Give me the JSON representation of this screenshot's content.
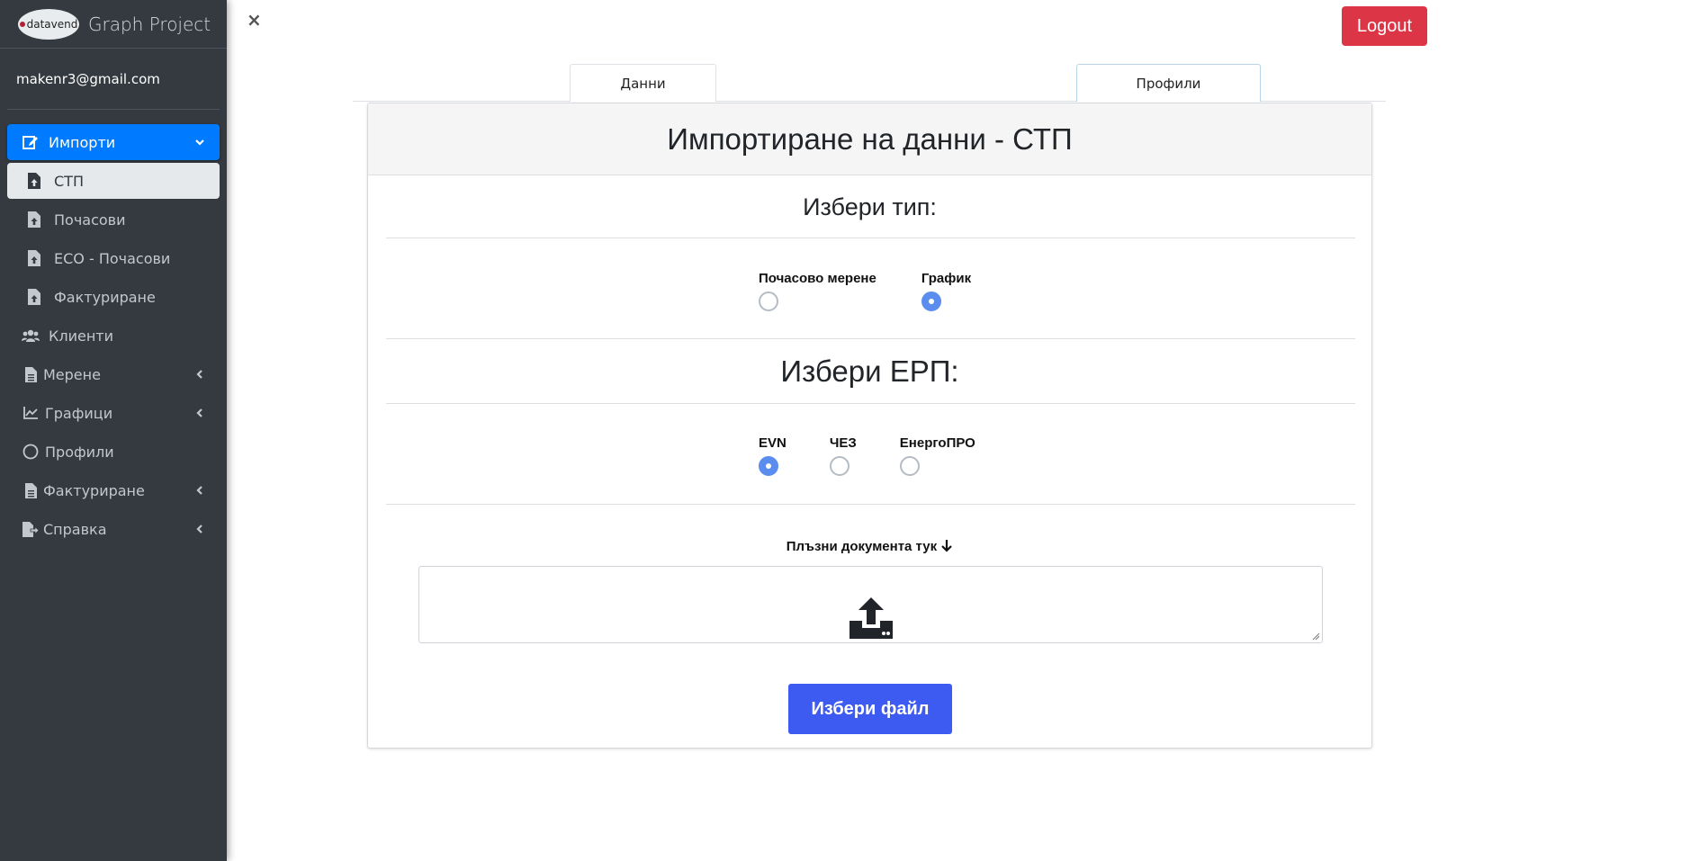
{
  "brand": {
    "logo_text": "datavend",
    "title": "Graph Project"
  },
  "user": {
    "email": "makenr3@gmail.com"
  },
  "sidebar": {
    "items": [
      {
        "label": "Импорти",
        "icon": "edit-icon"
      },
      {
        "label": "СТП",
        "icon": "file-upload-icon"
      },
      {
        "label": "Почасови",
        "icon": "file-upload-icon"
      },
      {
        "label": "ECO - Почасови",
        "icon": "file-upload-icon"
      },
      {
        "label": "Фактуриране",
        "icon": "file-upload-icon"
      },
      {
        "label": "Клиенти",
        "icon": "users-icon"
      },
      {
        "label": "Мерене",
        "icon": "file-text-icon"
      },
      {
        "label": "Графици",
        "icon": "chart-line-icon"
      },
      {
        "label": "Профили",
        "icon": "circle-icon"
      },
      {
        "label": "Фактуриране",
        "icon": "file-text-icon"
      },
      {
        "label": "Справка",
        "icon": "file-export-icon"
      }
    ]
  },
  "header": {
    "close_label": "×",
    "logout_label": "Logout"
  },
  "tabs": [
    {
      "label": "Данни"
    },
    {
      "label": "Профили"
    }
  ],
  "card": {
    "title": "Импортиране на данни - СТП",
    "type_section": {
      "title": "Избери тип:",
      "options": [
        {
          "label": "Почасово мерене",
          "checked": false
        },
        {
          "label": "График",
          "checked": true
        }
      ]
    },
    "erp_section": {
      "title": "Избери ЕРП:",
      "options": [
        {
          "label": "EVN",
          "checked": true
        },
        {
          "label": "ЧЕЗ",
          "checked": false
        },
        {
          "label": "ЕнергоПРО",
          "checked": false
        }
      ]
    },
    "drop_label": "Плъзни документа тук",
    "choose_button": "Избери файл"
  },
  "colors": {
    "sidebar_bg": "#343a40",
    "active": "#007bff",
    "logout": "#dc3545",
    "choose": "#3d5af1",
    "radio_checked": "#5b8def"
  }
}
